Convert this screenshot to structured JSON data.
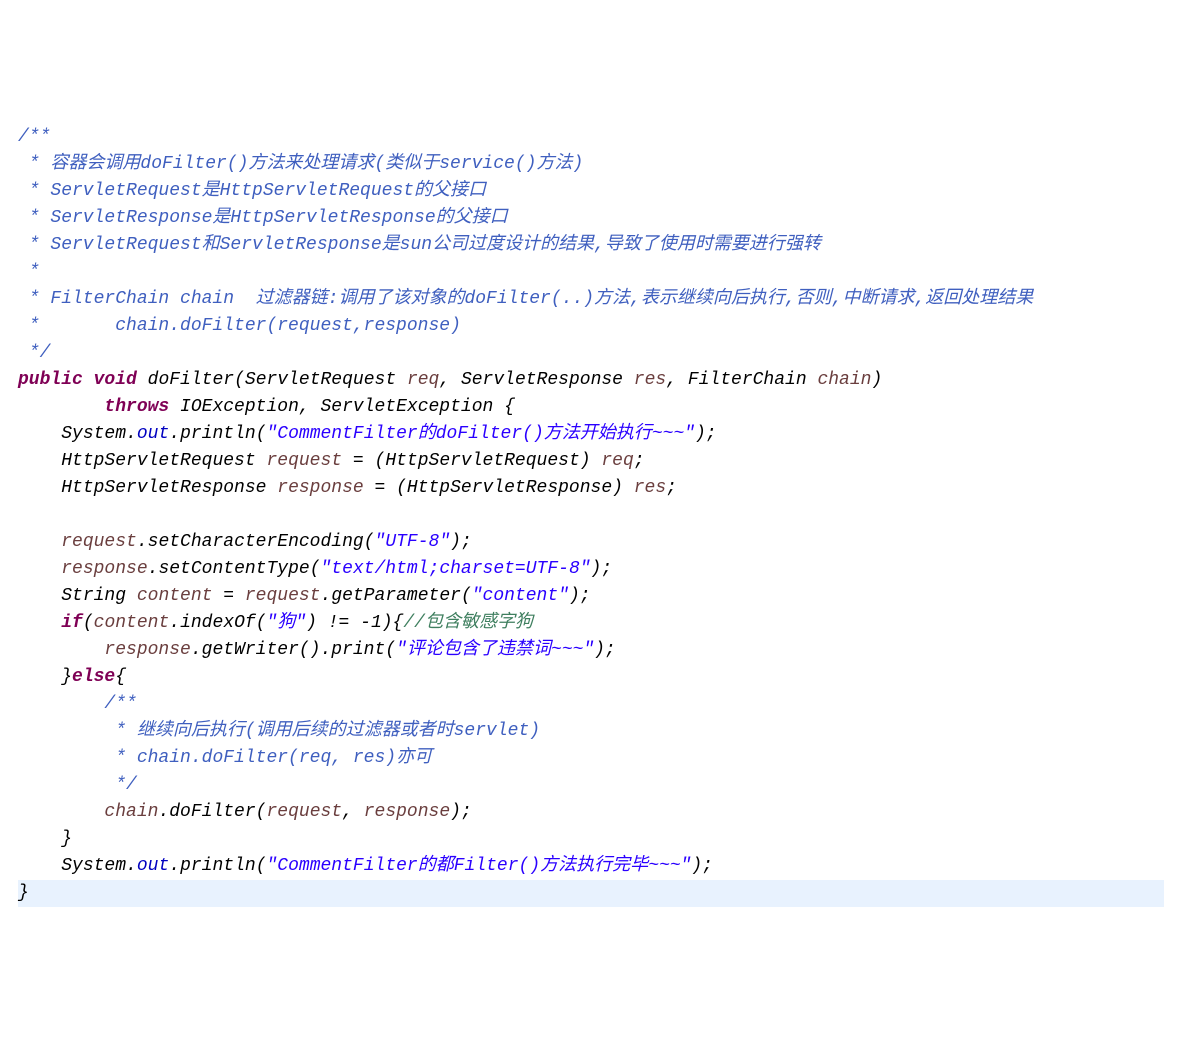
{
  "code": {
    "c1": "/**",
    "c2": " * 容器会调用doFilter()方法来处理请求(类似于service()方法)",
    "c3": " * ServletRequest是HttpServletRequest的父接口",
    "c4": " * ServletResponse是HttpServletResponse的父接口",
    "c5": " * ServletRequest和ServletResponse是sun公司过度设计的结果,导致了使用时需要进行强转",
    "c6": " *",
    "c7": " * FilterChain chain  过滤器链:调用了该对象的doFilter(..)方法,表示继续向后执行,否则,中断请求,返回处理结果",
    "c8": " *       chain.doFilter(request,response)",
    "c9": " */",
    "kw_public": "public",
    "kw_void": "void",
    "m_doFilter": "doFilter",
    "p_sr": "ServletRequest",
    "p_req": "req",
    "p_sres": "ServletResponse",
    "p_res": "res",
    "p_fc": "FilterChain",
    "p_chain": "chain",
    "kw_throws": "throws",
    "ex1": "IOException",
    "ex2": "ServletException",
    "sys": "System",
    "out": "out",
    "println": "println",
    "str1": "\"CommentFilter的doFilter()方法开始执行~~~\"",
    "hsr": "HttpServletRequest",
    "v_request": "request",
    "hsres": "HttpServletResponse",
    "v_response": "response",
    "setChar": "setCharacterEncoding",
    "str_utf": "\"UTF-8\"",
    "setCT": "setContentType",
    "str_ct": "\"text/html;charset=UTF-8\"",
    "t_string": "String",
    "v_content": "content",
    "getParam": "getParameter",
    "str_content": "\"content\"",
    "kw_if": "if",
    "indexOf": "indexOf",
    "str_dog": "\"狗\"",
    "neg1": "-1",
    "inlinec": "//包含敏感字狗",
    "getWriter": "getWriter",
    "print": "print",
    "str_ban": "\"评论包含了违禁词~~~\"",
    "kw_else": "else",
    "ic1": "/**",
    "ic2": " * 继续向后执行(调用后续的过滤器或者时servlet)",
    "ic3": " * chain.doFilter(req, res)亦可",
    "ic4": " */",
    "chaindo": "doFilter",
    "str2": "\"CommentFilter的都Filter()方法执行完毕~~~\"",
    "brace_end": "}"
  }
}
